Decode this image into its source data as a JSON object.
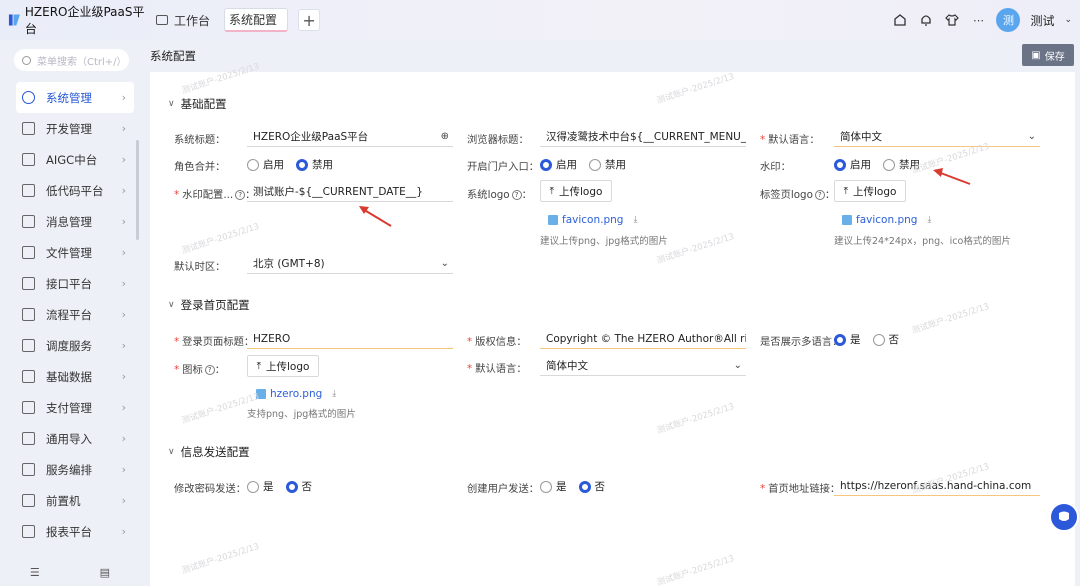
{
  "app": {
    "title": "HZERO企业级PaaS平台"
  },
  "tabs": [
    {
      "label": "工作台"
    },
    {
      "label": "系统配置"
    }
  ],
  "user": {
    "avatar_text": "测",
    "name": "测试"
  },
  "sidebar": {
    "search_placeholder": "菜单搜索（Ctrl+/）",
    "items": [
      {
        "label": "系统管理",
        "active": true
      },
      {
        "label": "开发管理"
      },
      {
        "label": "AIGC中台"
      },
      {
        "label": "低代码平台"
      },
      {
        "label": "消息管理"
      },
      {
        "label": "文件管理"
      },
      {
        "label": "接口平台"
      },
      {
        "label": "流程平台"
      },
      {
        "label": "调度服务"
      },
      {
        "label": "基础数据"
      },
      {
        "label": "支付管理"
      },
      {
        "label": "通用导入"
      },
      {
        "label": "服务编排"
      },
      {
        "label": "前置机"
      },
      {
        "label": "报表平台"
      }
    ]
  },
  "page": {
    "title": "系统配置",
    "save_label": "保存"
  },
  "basic": {
    "section_title": "基础配置",
    "system_title": {
      "label": "系统标题：",
      "value": "HZERO企业级PaaS平台"
    },
    "browser_title": {
      "label": "浏览器标题：",
      "value": "汉得凌鹭技术中台${__CURRENT_MENU_"
    },
    "default_lang": {
      "label": "默认语言：",
      "value": "简体中文"
    },
    "role_merge": {
      "label": "角色合并：",
      "options": [
        "启用",
        "禁用"
      ],
      "selected": "禁用"
    },
    "portal": {
      "label": "开启门户入口：",
      "options": [
        "启用",
        "禁用"
      ],
      "selected": "启用"
    },
    "watermark": {
      "label": "水印：",
      "options": [
        "启用",
        "禁用"
      ],
      "selected": "启用"
    },
    "watermark_config": {
      "label": "水印配置...",
      "value": "测试账户-${__CURRENT_DATE__}"
    },
    "system_logo": {
      "label": "系统logo",
      "upload_label": "上传logo",
      "file": "favicon.png",
      "hint": "建议上传png、jpg格式的图片"
    },
    "tab_logo": {
      "label": "标签页logo",
      "upload_label": "上传logo",
      "file": "favicon.png",
      "hint": "建议上传24*24px，png、ico格式的图片"
    },
    "timezone": {
      "label": "默认时区：",
      "value": "北京 (GMT+8)"
    }
  },
  "login": {
    "section_title": "登录首页配置",
    "page_title": {
      "label": "登录页面标题：",
      "value": "HZERO"
    },
    "copyright": {
      "label": "版权信息：",
      "value": "Copyright © The HZERO Author®All rights r"
    },
    "multi_lang": {
      "label": "是否展示多语言：",
      "options": [
        "是",
        "否"
      ],
      "selected": "是"
    },
    "icon": {
      "label": "图标",
      "upload_label": "上传logo",
      "file": "hzero.png",
      "hint": "支持png、jpg格式的图片"
    },
    "default_lang": {
      "label": "默认语言：",
      "value": "简体中文"
    }
  },
  "info": {
    "section_title": "信息发送配置",
    "pwd_send": {
      "label": "修改密码发送：",
      "options": [
        "是",
        "否"
      ],
      "selected": "否"
    },
    "user_send": {
      "label": "创建用户发送：",
      "options": [
        "是",
        "否"
      ],
      "selected": "否"
    },
    "home_link": {
      "label": "首页地址链接：",
      "value": "https://hzeronf.saas.hand-china.com"
    }
  },
  "watermark_text": "测试账户-2025/2/13",
  "colors": {
    "primary": "#2b59d9",
    "required": "#e8443a",
    "arrow": "#d93a30"
  }
}
